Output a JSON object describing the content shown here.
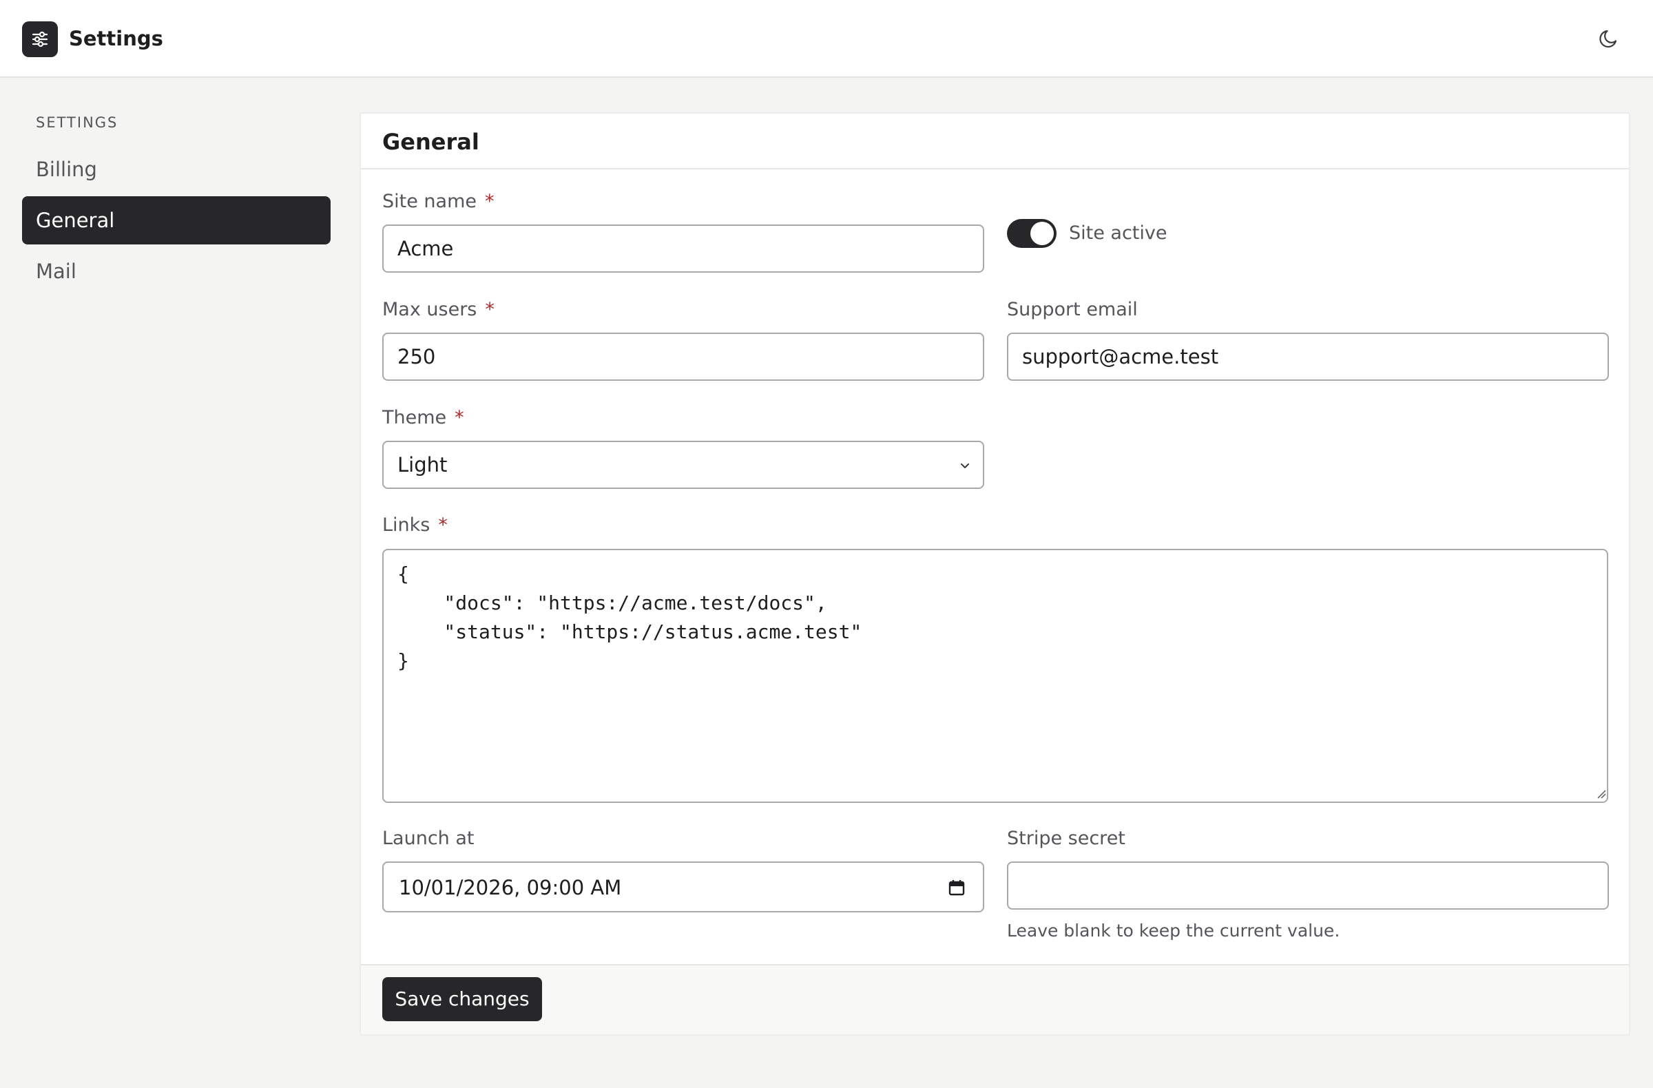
{
  "app": {
    "title": "Settings"
  },
  "sidebar": {
    "heading": "SETTINGS",
    "items": [
      {
        "label": "Billing",
        "active": false
      },
      {
        "label": "General",
        "active": true
      },
      {
        "label": "Mail",
        "active": false
      }
    ]
  },
  "panel": {
    "title": "General",
    "fields": {
      "site_name": {
        "label": "Site name",
        "required": "*",
        "value": "Acme"
      },
      "site_active": {
        "label": "Site active",
        "on": true
      },
      "max_users": {
        "label": "Max users",
        "required": "*",
        "value": "250"
      },
      "support_email": {
        "label": "Support email",
        "value": "support@acme.test"
      },
      "theme": {
        "label": "Theme",
        "required": "*",
        "value": "Light"
      },
      "links": {
        "label": "Links",
        "required": "*",
        "value": "{\n    \"docs\": \"https://acme.test/docs\",\n    \"status\": \"https://status.acme.test\"\n}"
      },
      "launch_at": {
        "label": "Launch at",
        "value": "10/01/2026, 09:00 AM"
      },
      "stripe_secret": {
        "label": "Stripe secret",
        "value": "",
        "helper": "Leave blank to keep the current value."
      }
    },
    "save_label": "Save changes"
  },
  "icons": {
    "logo": "sliders-icon",
    "theme_toggle": "moon-icon",
    "select": "chevron-down-icon",
    "date": "calendar-icon"
  },
  "colors": {
    "accent": "#27272a",
    "required": "#b02a2a",
    "background": "#f4f4f2"
  }
}
